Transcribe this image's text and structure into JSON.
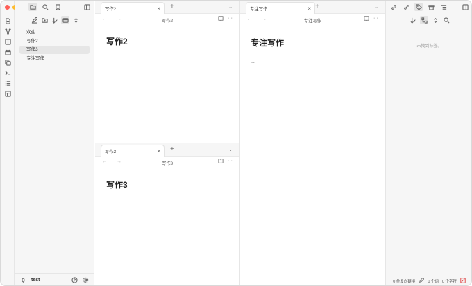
{
  "colors": {
    "close": "#ff5f57",
    "minimize": "#febc2e",
    "zoom": "#28c840"
  },
  "ribbon": {
    "icons": [
      "file-plus-icon",
      "graph-icon",
      "canvas-icon",
      "calendar-icon",
      "copy-icon",
      "terminal-icon",
      "list-icon",
      "template-icon"
    ]
  },
  "sidebar": {
    "files": [
      {
        "label": "欢迎",
        "active": false
      },
      {
        "label": "写作2",
        "active": false
      },
      {
        "label": "写作3",
        "active": true
      },
      {
        "label": "专注写作",
        "active": false
      }
    ],
    "vault_name": "test"
  },
  "pane_top_left": {
    "tab_label": "写作2",
    "nav_title": "写作2",
    "doc_title": "写作2"
  },
  "pane_bottom_left": {
    "tab_label": "写作3",
    "nav_title": "写作3",
    "doc_title": "写作3"
  },
  "pane_right": {
    "tab_label": "专注写作",
    "nav_title": "专注写作",
    "doc_title": "专注写作",
    "doc_body": "..."
  },
  "right_panel": {
    "empty_message": "未找到标签。"
  },
  "status_bar": {
    "backlinks": "0 条反向链接",
    "words": "0 个词",
    "chars": "0 个字符"
  },
  "glyphs": {
    "close": "×",
    "plus": "+",
    "more": "···",
    "arrows": "← →",
    "chevron": "⌄"
  }
}
